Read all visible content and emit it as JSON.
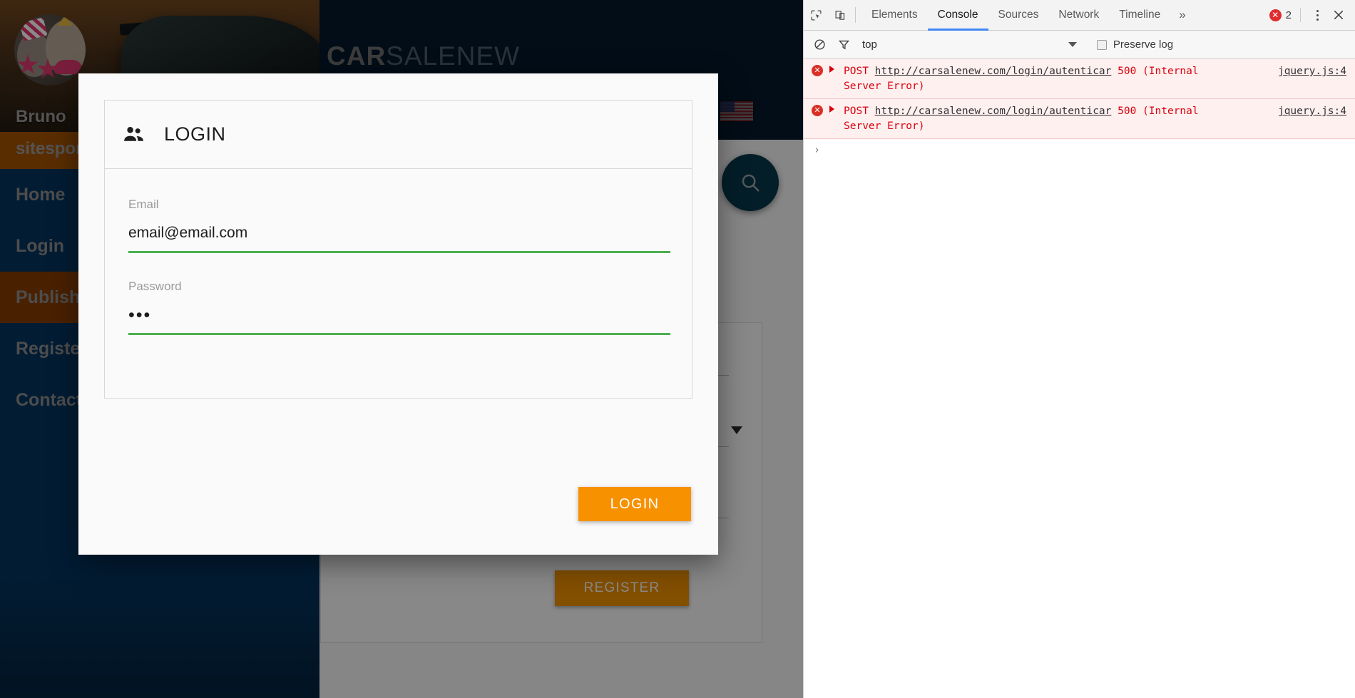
{
  "site": {
    "logo_bold": "CAR",
    "logo_thin": "SALENEW",
    "flag_icon": "us-flag-icon",
    "search_icon": "search-icon"
  },
  "sidebar": {
    "profile": {
      "name": "Bruno",
      "site": "sitespor",
      "avatar_icon": "user-avatar-photo"
    },
    "items": [
      {
        "label": "Home",
        "active": false
      },
      {
        "label": "Login",
        "active": false
      },
      {
        "label": "Publish",
        "active": true
      },
      {
        "label": "Register",
        "active": false
      },
      {
        "label": "Contact",
        "active": false
      }
    ]
  },
  "background_form": {
    "dropdown_caret_icon": "chevron-down-icon",
    "register_label": "REGISTER"
  },
  "login_modal": {
    "icon": "people-icon",
    "title": "LOGIN",
    "fields": [
      {
        "label": "Email",
        "value": "email@email.com",
        "underline_color": "#4caf50"
      },
      {
        "label": "Password",
        "value": "•••",
        "underline_color": "#4caf50"
      }
    ],
    "submit_label": "LOGIN",
    "submit_color": "#f79100"
  },
  "devtools": {
    "inspect_icon": "inspect-element-icon",
    "device_icon": "device-toolbar-icon",
    "tabs": [
      {
        "label": "Elements",
        "active": false
      },
      {
        "label": "Console",
        "active": true
      },
      {
        "label": "Sources",
        "active": false
      },
      {
        "label": "Network",
        "active": false
      },
      {
        "label": "Timeline",
        "active": false
      }
    ],
    "more_tabs_label": "»",
    "error_badge": {
      "icon": "error-icon",
      "count": "2"
    },
    "kebab_icon": "more-options-icon",
    "close_icon": "close-icon",
    "filterbar": {
      "clear_icon": "clear-console-icon",
      "filter_icon": "filter-icon",
      "context": "top",
      "context_caret_icon": "chevron-down-icon",
      "preserve_log_label": "Preserve log",
      "preserve_log_checked": false
    },
    "messages": [
      {
        "icon": "error-icon",
        "expand_icon": "expand-triangle-icon",
        "method": "POST",
        "url": "http://carsalenew.com/login/autenticar",
        "status": "500 (Internal",
        "status_cont": "Server Error)",
        "source": "jquery.js:4"
      },
      {
        "icon": "error-icon",
        "expand_icon": "expand-triangle-icon",
        "method": "POST",
        "url": "http://carsalenew.com/login/autenticar",
        "status": "500 (Internal",
        "status_cont": "Server Error)",
        "source": "jquery.js:4"
      }
    ],
    "prompt_symbol": "›"
  }
}
